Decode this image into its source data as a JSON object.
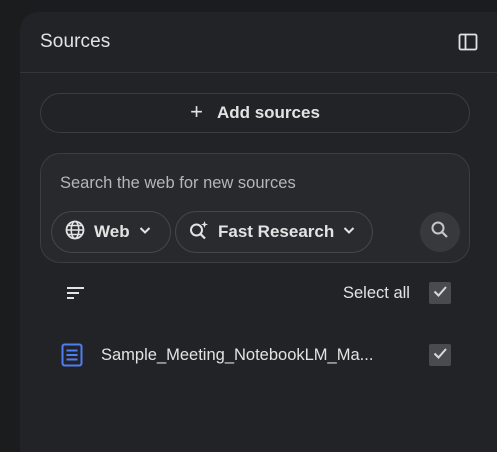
{
  "panel": {
    "title": "Sources"
  },
  "add_sources": {
    "plus": "+",
    "label": "Add sources"
  },
  "search": {
    "placeholder": "Search the web for new sources",
    "source_chip": {
      "label": "Web",
      "icon": "globe-icon"
    },
    "mode_chip": {
      "label": "Fast Research",
      "icon": "research-sparkle-icon"
    },
    "submit_icon": "search-icon"
  },
  "list": {
    "sort_icon": "sort-icon",
    "select_all_label": "Select all",
    "select_all_checked": true,
    "sources": [
      {
        "name": "Sample_Meeting_NotebookLM_Ma...",
        "icon": "document-icon",
        "checked": true
      }
    ]
  },
  "colors": {
    "background": "#1b1c1e",
    "panel": "#222326",
    "doc_icon": "#4d7ef7",
    "text": "#e3e3e3"
  }
}
